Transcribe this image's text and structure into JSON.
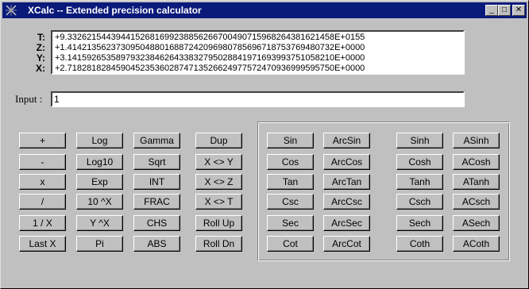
{
  "window": {
    "title": "XCalc -- Extended precision calculator",
    "min_glyph": "_",
    "max_glyph": "□",
    "close_glyph": "✕",
    "title_color": "#0a1a7a"
  },
  "stack": {
    "labels": [
      "T:",
      "Z:",
      "Y:",
      "X:"
    ],
    "values": [
      "+9.3326215443944152681699238856266700490715968264381621458E+0155",
      "+1.4142135623730950488016887242096980785696718753769480732E+0000",
      "+3.1415926535897932384626433832795028841971693993751058210E+0000",
      "+2.7182818284590452353602874713526624977572470936999595750E+0000"
    ]
  },
  "input": {
    "label": "Input :",
    "value": "1"
  },
  "buttons": [
    [
      "+",
      "Log",
      "Gamma",
      "Dup",
      "Sin",
      "ArcSin",
      "Sinh",
      "ASinh"
    ],
    [
      "-",
      "Log10",
      "Sqrt",
      "X <> Y",
      "Cos",
      "ArcCos",
      "Cosh",
      "ACosh"
    ],
    [
      "x",
      "Exp",
      "INT",
      "X <> Z",
      "Tan",
      "ArcTan",
      "Tanh",
      "ATanh"
    ],
    [
      "/",
      "10 ^X",
      "FRAC",
      "X <> T",
      "Csc",
      "ArcCsc",
      "Csch",
      "ACsch"
    ],
    [
      "1 / X",
      "Y ^X",
      "CHS",
      "Roll Up",
      "Sec",
      "ArcSec",
      "Sech",
      "ASech"
    ],
    [
      "Last X",
      "Pi",
      "ABS",
      "Roll Dn",
      "Cot",
      "ArcCot",
      "Coth",
      "ACoth"
    ]
  ]
}
